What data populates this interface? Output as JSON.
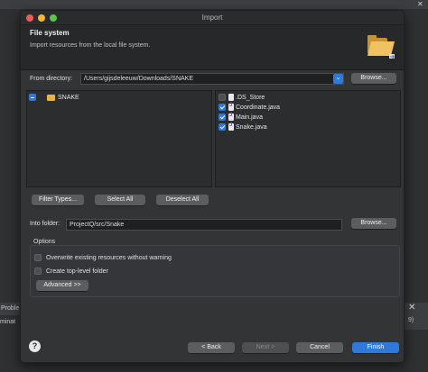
{
  "background": {
    "problems_tab": "Proble",
    "problems_line2": "minat",
    "right_number": "9)"
  },
  "dialog": {
    "title": "Import",
    "header_title": "File system",
    "header_desc": "Import resources from the local file system.",
    "from_directory_label": "From directory:",
    "from_directory_value": "/Users/gijsdeleeuw/Downloads/SNAKE",
    "browse_label": "Browse...",
    "tree": {
      "folder_name": "SNAKE",
      "folder_state": "mixed"
    },
    "files": [
      {
        "name": ".DS_Store",
        "checked": false,
        "type": "file"
      },
      {
        "name": "Coordinate.java",
        "checked": true,
        "type": "java"
      },
      {
        "name": "Main.java",
        "checked": true,
        "type": "java"
      },
      {
        "name": "Snake.java",
        "checked": true,
        "type": "java"
      }
    ],
    "filter_types_label": "Filter Types...",
    "select_all_label": "Select All",
    "deselect_all_label": "Deselect All",
    "into_folder_label": "Into folder:",
    "into_folder_value": "ProjectQ/src/Snake",
    "browse2_label": "Browse...",
    "options": {
      "title": "Options",
      "overwrite_label": "Overwrite existing resources without warning",
      "overwrite_checked": false,
      "create_top_level_label": "Create top-level folder",
      "create_top_level_checked": false,
      "advanced_label": "Advanced >>"
    },
    "footer": {
      "help_symbol": "?",
      "back_label": "< Back",
      "next_label": "Next >",
      "cancel_label": "Cancel",
      "finish_label": "Finish"
    }
  },
  "colors": {
    "accent": "#2f7ad9",
    "folder": "#e8b24a"
  }
}
